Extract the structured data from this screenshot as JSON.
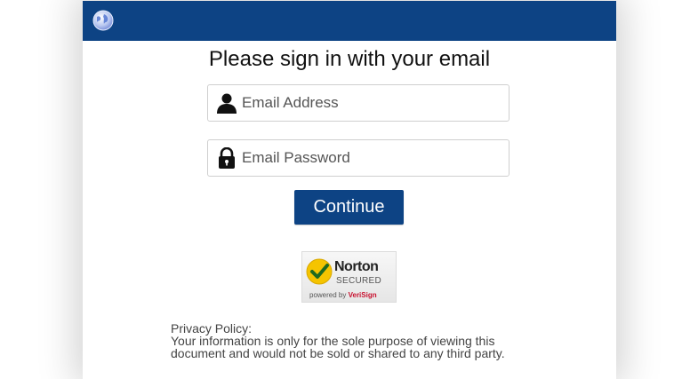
{
  "header": {
    "globe_icon": "globe-icon",
    "bar_color": "#0d4384"
  },
  "title": "Please sign in with your email",
  "email_field": {
    "placeholder": "Email Address",
    "value": "",
    "icon": "user-icon"
  },
  "password_field": {
    "placeholder": "Email Password",
    "value": "",
    "icon": "lock-icon"
  },
  "continue_button": {
    "label": "Continue",
    "color": "#0d4384"
  },
  "badge": {
    "brand": "Norton",
    "secured": "SECURED",
    "powered_prefix": "powered by",
    "powered_brand": "VeriSign"
  },
  "privacy": {
    "heading": "Privacy Policy:",
    "line1": "Your information is only for the sole purpose of viewing this",
    "line2": "document and would not be sold or shared to any third party."
  }
}
